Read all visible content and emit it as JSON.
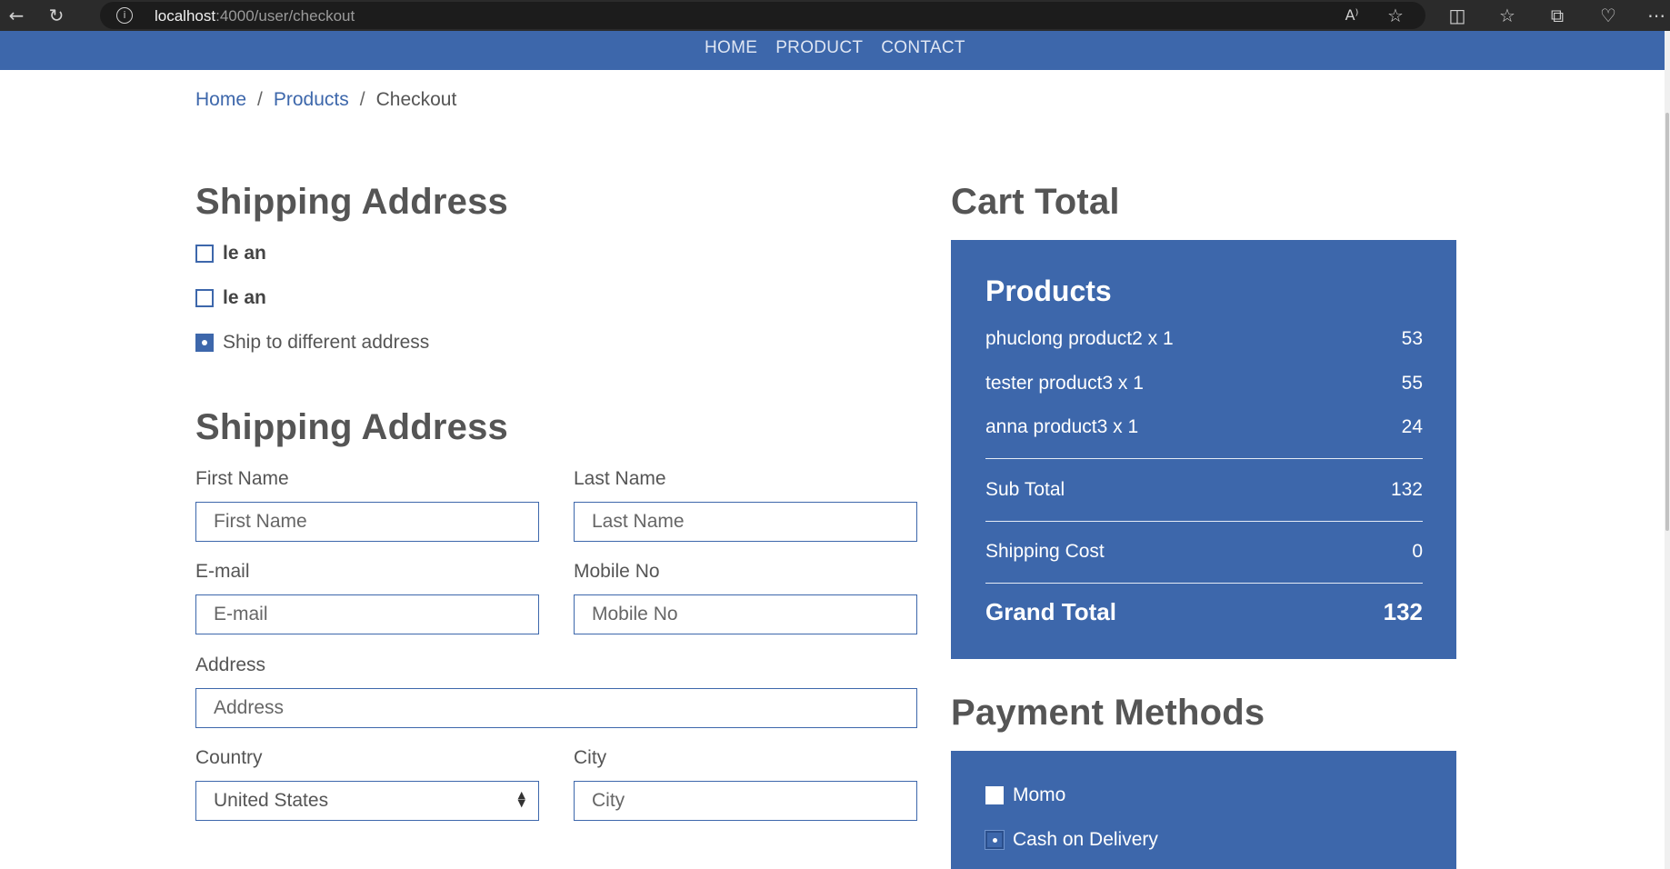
{
  "browser": {
    "url_host": "localhost",
    "url_path": ":4000/user/checkout",
    "back_icon": "back-arrow-icon",
    "reload_icon": "reload-icon",
    "info_icon": "info-icon"
  },
  "nav": {
    "items": [
      "HOME",
      "PRODUCT",
      "CONTACT"
    ]
  },
  "breadcrumb": {
    "home": "Home",
    "products": "Products",
    "current": "Checkout",
    "separator": "/"
  },
  "shipping_select": {
    "title": "Shipping Address",
    "options": [
      {
        "label": "le an",
        "checked": false
      },
      {
        "label": "le an",
        "checked": false
      },
      {
        "label": "Ship to different address",
        "checked": true
      }
    ]
  },
  "shipping_form": {
    "title": "Shipping Address",
    "first_name": {
      "label": "First Name",
      "placeholder": "First Name"
    },
    "last_name": {
      "label": "Last Name",
      "placeholder": "Last Name"
    },
    "email": {
      "label": "E-mail",
      "placeholder": "E-mail"
    },
    "mobile": {
      "label": "Mobile No",
      "placeholder": "Mobile No"
    },
    "address": {
      "label": "Address",
      "placeholder": "Address"
    },
    "country": {
      "label": "Country",
      "value": "United States"
    },
    "city": {
      "label": "City",
      "placeholder": "City"
    }
  },
  "cart": {
    "title": "Cart Total",
    "products_heading": "Products",
    "items": [
      {
        "name": "phuclong product2 x 1",
        "price": "53"
      },
      {
        "name": "tester product3 x 1",
        "price": "55"
      },
      {
        "name": "anna product3 x 1",
        "price": "24"
      }
    ],
    "sub_total_label": "Sub Total",
    "sub_total": "132",
    "shipping_label": "Shipping Cost",
    "shipping": "0",
    "grand_total_label": "Grand Total",
    "grand_total": "132"
  },
  "payment": {
    "title": "Payment Methods",
    "options": [
      {
        "label": "Momo",
        "checked": false
      },
      {
        "label": "Cash on Delivery",
        "checked": true
      }
    ]
  },
  "colors": {
    "brand": "#3d67ab",
    "heading": "#555555"
  }
}
